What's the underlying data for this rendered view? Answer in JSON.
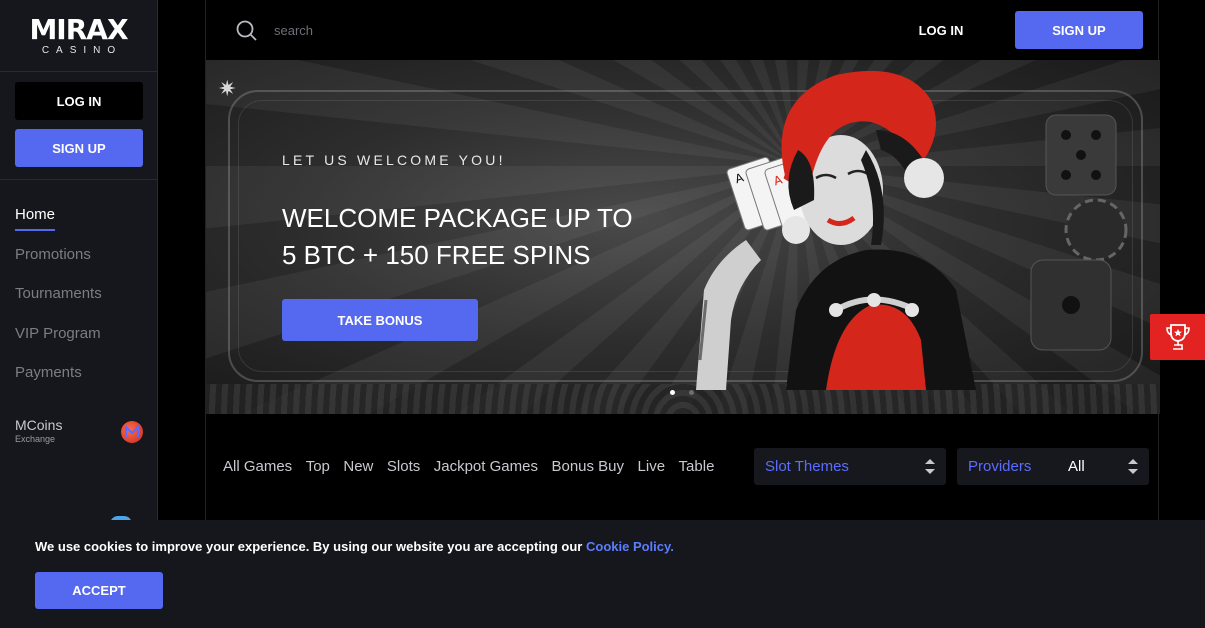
{
  "brand": {
    "logo_text": "MIRAX",
    "logo_sub": "CASINO"
  },
  "sidebar": {
    "login_label": "LOG IN",
    "signup_label": "SIGN UP",
    "items": [
      {
        "label": "Home",
        "active": true
      },
      {
        "label": "Promotions"
      },
      {
        "label": "Tournaments"
      },
      {
        "label": "VIP Program"
      },
      {
        "label": "Payments"
      }
    ],
    "mcoins": {
      "title": "MCoins",
      "subtitle": "Exchange",
      "icon": "mcoins-exchange-icon"
    }
  },
  "header": {
    "search": {
      "placeholder": "search",
      "icon": "search-icon"
    },
    "login_label": "LOG IN",
    "signup_label": "SIGN UP"
  },
  "banner": {
    "eyebrow": "LET US WELCOME YOU!",
    "headline_line1": "WELCOME PACKAGE UP TO",
    "headline_line2": "5 BTC + 150 FREE SPINS",
    "cta_label": "TAKE BONUS",
    "slides": 2,
    "active_slide": 1
  },
  "games": {
    "tabs": [
      "All Games",
      "Top",
      "New",
      "Slots",
      "Jackpot Games",
      "Bonus Buy",
      "Live",
      "Table"
    ],
    "slot_themes_label": "Slot Themes",
    "providers_label": "Providers",
    "providers_value": "All"
  },
  "side_widget": {
    "icon": "trophy-icon"
  },
  "cookie": {
    "text": "We use cookies to improve your experience. By using our website you are accepting our ",
    "link_label": "Cookie Policy.",
    "accept_label": "ACCEPT"
  },
  "colors": {
    "accent": "#5468f0",
    "link": "#5b7dff",
    "sidebar_bg": "#16171c",
    "trophy_bg": "#e32222"
  }
}
